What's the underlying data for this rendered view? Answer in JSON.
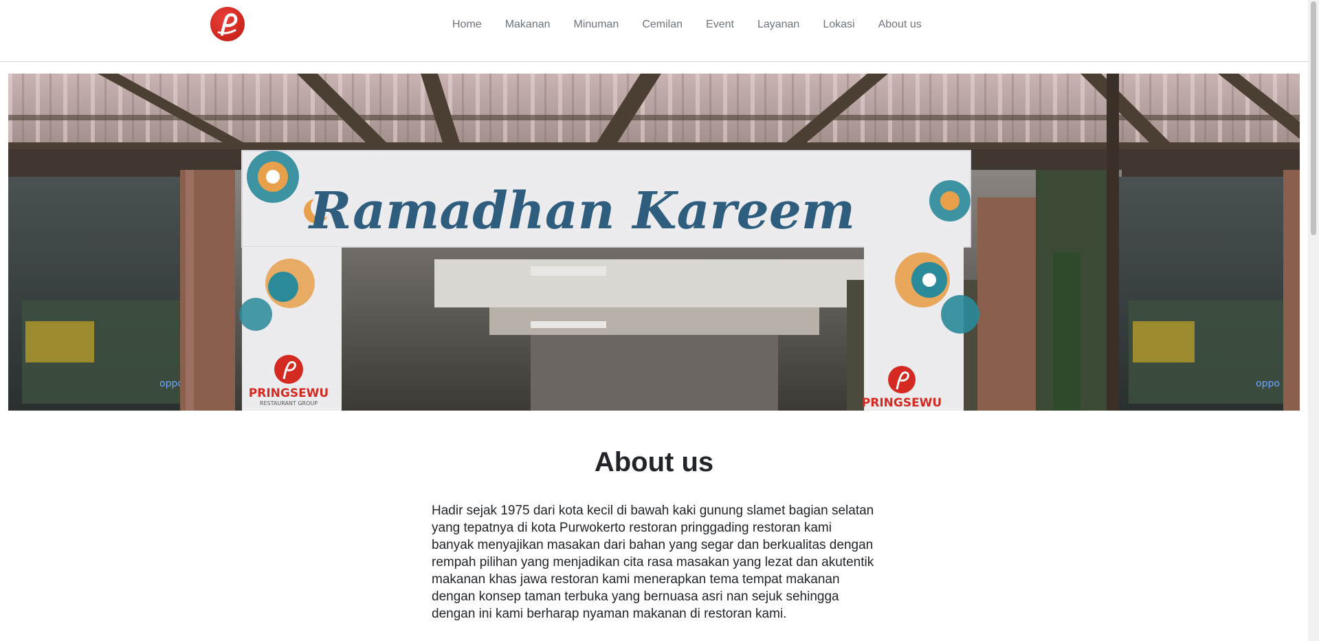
{
  "brand": {
    "logo_icon": "pringsewu-p-logo-icon",
    "color": "#d42a22"
  },
  "nav": {
    "items": [
      {
        "label": "Home"
      },
      {
        "label": "Makanan"
      },
      {
        "label": "Minuman"
      },
      {
        "label": "Cemilan"
      },
      {
        "label": "Event"
      },
      {
        "label": "Layanan"
      },
      {
        "label": "Lokasi"
      },
      {
        "label": "About us"
      }
    ]
  },
  "hero": {
    "banner_text": "Ramadhan Kareem",
    "brand_text": "PRINGSEWU",
    "brand_subtext": "RESTAURANT GROUP"
  },
  "about": {
    "title": "About us",
    "body": "Hadir sejak 1975 dari kota kecil di bawah kaki gunung slamet bagian selatan yang tepatnya di kota Purwokerto restoran pringgading restoran kami banyak menyajikan masakan dari bahan yang segar dan berkualitas dengan rempah pilihan yang menjadikan cita rasa masakan yang lezat dan akutentik makanan khas jawa restoran kami menerapkan tema tempat makanan dengan konsep taman terbuka yang bernuasa asri nan sejuk sehingga dengan ini kami berharap nyaman makanan di restoran kami."
  },
  "colors": {
    "nav_text": "#6c757d",
    "heading": "#212529",
    "banner_script": "#2e5d7e",
    "accent_orange": "#e8a04a",
    "accent_teal": "#2a8a99"
  }
}
